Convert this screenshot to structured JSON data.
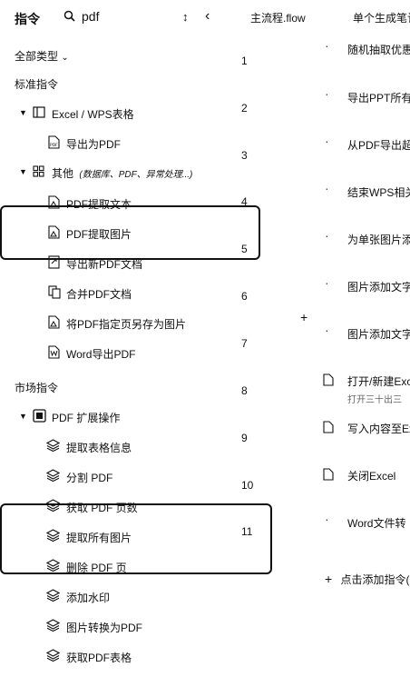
{
  "header": {
    "title": "指令",
    "search_value": "pdf",
    "sort_label": "↕",
    "collapse_label": "‹",
    "tabs": [
      "主流程.flow",
      "单个生成笔记"
    ]
  },
  "filter": {
    "label": "全部类型"
  },
  "sections": {
    "standard": "标准指令",
    "market": "市场指令"
  },
  "groups": {
    "excel": "Excel / WPS表格",
    "other_name": "其他",
    "other_desc": "(数据库、PDF、异常处理...)",
    "pdf_ext": "PDF 扩展操作"
  },
  "items": {
    "export_pdf": "导出为PDF",
    "pdf_text": "PDF提取文本",
    "pdf_image": "PDF提取图片",
    "export_new_pdf": "导出新PDF文档",
    "merge_pdf": "合并PDF文档",
    "save_pages_img": "将PDF指定页另存为图片",
    "word_pdf": "Word导出PDF",
    "ext_table_info": "提取表格信息",
    "ext_split": "分割 PDF",
    "ext_page_count": "获取 PDF 页数",
    "ext_all_images": "提取所有图片",
    "ext_delete_page": "删除 PDF 页",
    "ext_watermark": "添加水印",
    "ext_img_to_pdf": "图片转换为PDF",
    "ext_get_tables": "获取PDF表格"
  },
  "line_numbers": [
    "1",
    "2",
    "3",
    "4",
    "5",
    "6",
    "7",
    "8",
    "9",
    "10",
    "11"
  ],
  "steps": {
    "s1": "随机抽取优惠",
    "s2": "导出PPT所有",
    "s3": "从PDF导出超",
    "s4": "结束WPS相关",
    "s5": "为单张图片添",
    "s6": "图片添加文字",
    "s7": "图片添加文字",
    "s8": "打开/新建Exc",
    "s8_sub": "打开三十出三",
    "s9": "写入内容至Ex",
    "s10": "关闭Excel",
    "s11": "Word文件转"
  },
  "add_step": "点击添加指令("
}
